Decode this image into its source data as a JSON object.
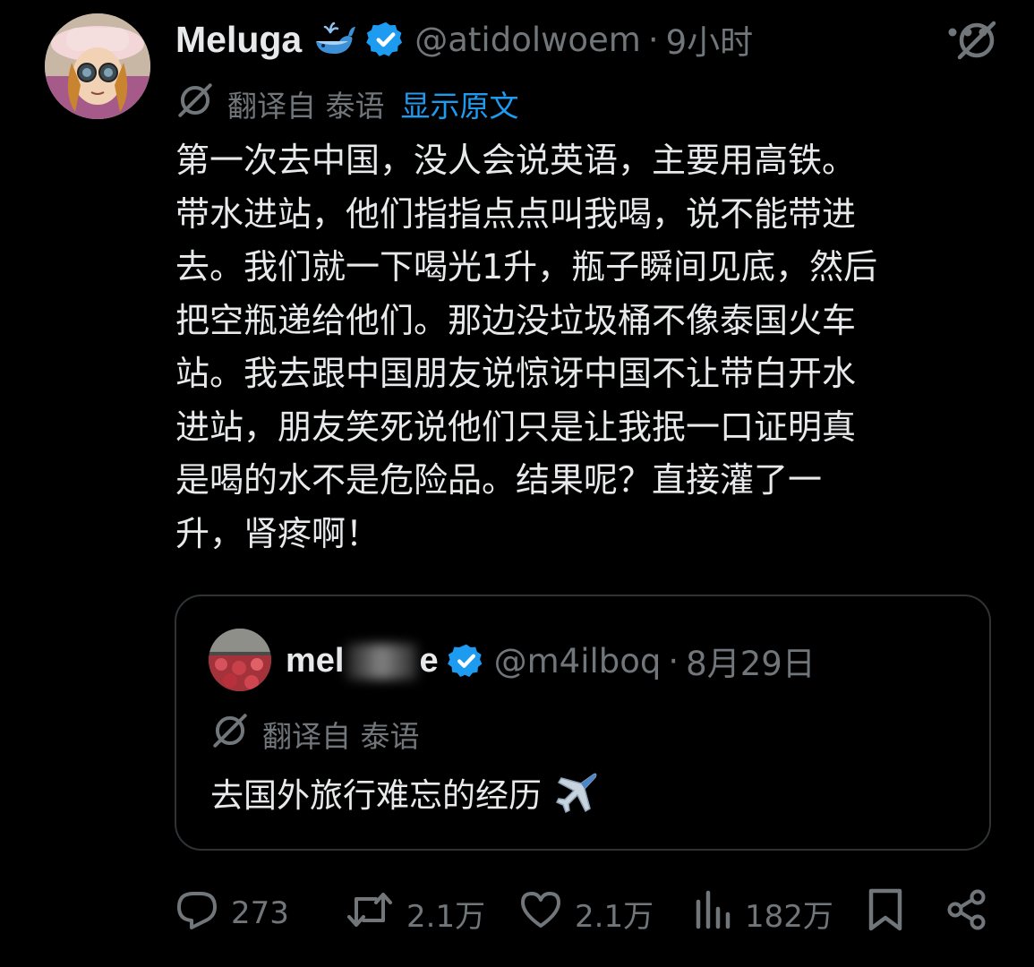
{
  "tweet": {
    "author_name": "Meluga",
    "author_handle": "@atidolwoem",
    "separator": "·",
    "time": "9小时",
    "translate_label": "翻译自 泰语",
    "show_original": "显示原文",
    "lines": [
      "第一次去中国，没人会说英语，主要用高铁。",
      "带水进站，他们指指点点叫我喝，说不能带进",
      "去。我们就一下喝光1升，瓶子瞬间见底，然后",
      "把空瓶递给他们。那边没垃圾桶不像泰国火车",
      "站。我去跟中国朋友说惊讶中国不让带白开水",
      "进站，朋友笑死说他们只是让我抿一口证明真",
      "是喝的水不是危险品。结果呢？直接灌了一",
      "升，肾疼啊！"
    ]
  },
  "quoted": {
    "name_prefix": "mel",
    "name_suffix": "e",
    "handle": "@m4ilboq",
    "separator": "·",
    "date": "8月29日",
    "translate_label": "翻译自 泰语",
    "text": "去国外旅行难忘的经历"
  },
  "actions": {
    "replies": "273",
    "retweets": "2.1万",
    "likes": "2.1万",
    "views": "182万"
  },
  "colors": {
    "background": "#000000",
    "text": "#e7e9ea",
    "muted": "#71767b",
    "accent": "#1d9bf0",
    "border": "#2f3336"
  },
  "icons": [
    "whale-emoji-icon",
    "verified-badge-icon",
    "grok-icon",
    "more-icon",
    "translate-icon",
    "airplane-emoji-icon",
    "reply-icon",
    "retweet-icon",
    "like-icon",
    "views-icon",
    "bookmark-icon",
    "share-icon"
  ]
}
